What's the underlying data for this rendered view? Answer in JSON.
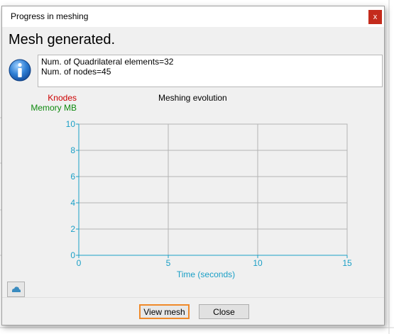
{
  "window": {
    "title": "Progress in meshing",
    "close_label": "x"
  },
  "status": {
    "heading": "Mesh generated.",
    "messages": [
      "Num. of Quadrilateral elements=32",
      "Num. of nodes=45"
    ]
  },
  "chart_data": {
    "type": "line",
    "title": "Meshing evolution",
    "xlabel": "Time (seconds)",
    "xlim": [
      0,
      15
    ],
    "ylim": [
      0,
      10
    ],
    "x_ticks": [
      "0",
      "5",
      "10",
      "15"
    ],
    "y_ticks": [
      "0",
      "2",
      "4",
      "6",
      "8",
      "10"
    ],
    "grid": true,
    "series": [
      {
        "name": "Knodes",
        "color": "#cc0000",
        "x": [],
        "y": []
      },
      {
        "name": "Memory MB",
        "color": "#0f8a0f",
        "x": [],
        "y": []
      }
    ],
    "axis_color": "#1a9fc6"
  },
  "buttons": {
    "view_mesh": "View mesh",
    "close": "Close"
  },
  "icons": {
    "info": "info-icon",
    "collapse": "cloud-up-icon"
  }
}
